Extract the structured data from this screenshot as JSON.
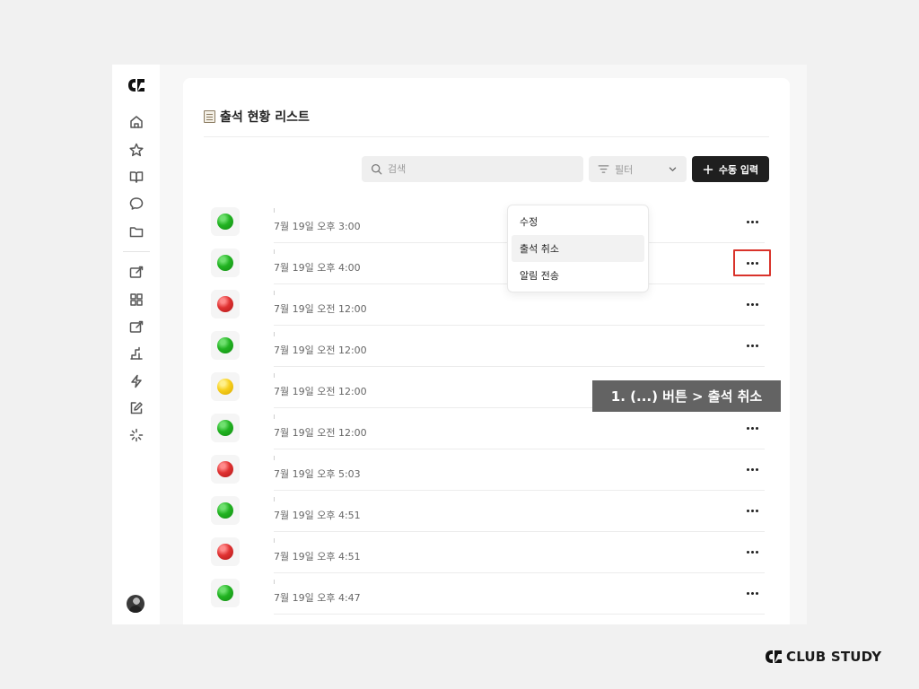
{
  "page": {
    "title": "출석 현황 리스트"
  },
  "toolbar": {
    "search_placeholder": "검색",
    "filter_label": "필터",
    "add_label": "수동 입력"
  },
  "sidebar": {
    "icons": [
      "home-icon",
      "star-icon",
      "book-icon",
      "chat-icon",
      "folder-icon",
      "edit-square-icon",
      "grid-icon",
      "edit-square-icon",
      "chart-icon",
      "bolt-icon",
      "sparkle-edit-icon",
      "loader-icon"
    ]
  },
  "rows": [
    {
      "status": "green",
      "time": "7월 19일 오후 3:00"
    },
    {
      "status": "green",
      "time": "7월 19일 오후 4:00",
      "menu_open": true
    },
    {
      "status": "red",
      "time": "7월 19일 오전 12:00"
    },
    {
      "status": "green",
      "time": "7월 19일 오전 12:00"
    },
    {
      "status": "yellow",
      "time": "7월 19일 오전 12:00"
    },
    {
      "status": "green",
      "time": "7월 19일 오전 12:00"
    },
    {
      "status": "red",
      "time": "7월 19일 오후 5:03"
    },
    {
      "status": "green",
      "time": "7월 19일 오후 4:51"
    },
    {
      "status": "red",
      "time": "7월 19일 오후 4:51"
    },
    {
      "status": "green",
      "time": "7월 19일 오후 4:47"
    }
  ],
  "context_menu": {
    "items": [
      "수정",
      "출석 취소",
      "알림 전송"
    ],
    "highlighted": 1
  },
  "instruction_note": "1. (...) 버튼 > 출석 취소",
  "brand": {
    "name": "CLUB STUDY"
  },
  "colors": {
    "green": "#22b322",
    "red": "#e03232",
    "yellow": "#f7cf1c",
    "highlight_border": "#d9332b",
    "primary_button": "#1f1f1f"
  }
}
